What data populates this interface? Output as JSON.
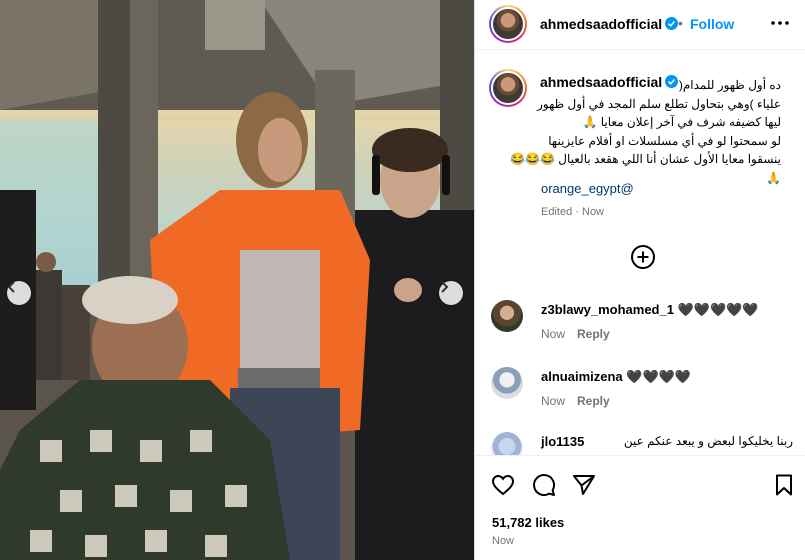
{
  "post": {
    "username": "ahmedsaadofficial",
    "follow_label": "Follow",
    "separator": "•",
    "caption_lines": [
      "ده أول ظهور للمدام( ",
      "علياء )وهي بتحاول تطلع سلم المجد في أول ظهور",
      "ليها كضيفه شرف في آخر إعلان معايا 🙏",
      "لو سمحتوا لو في أي مسلسلات او أفلام عايزينها",
      "ينسقوا معايا الأول عشان أنا اللي هقعد بالعيال 😂😂😂",
      "🙏"
    ],
    "mention": "orange_egypt@",
    "edited_label": "Edited",
    "edited_sep": "·",
    "edited_time": "Now",
    "likes": "51,782 likes",
    "post_time": "Now"
  },
  "comments": [
    {
      "username": "z3blawy_mohamed_1",
      "text": "🖤🖤🖤🖤🖤",
      "time": "Now",
      "reply": "Reply"
    },
    {
      "username": "alnuaimizena",
      "text": "🖤🖤🖤🖤",
      "time": "Now",
      "reply": "Reply"
    },
    {
      "username": "jlo1135",
      "text": "ربنا يخليكوا لبعض و يبعد عنكم عين",
      "time": "",
      "reply": ""
    }
  ],
  "icons": {
    "verified": "verified-badge-icon",
    "more": "more-options-icon",
    "add": "add-comment-circle-icon",
    "like": "heart-icon",
    "comment": "comment-icon",
    "share": "share-icon",
    "save": "bookmark-icon",
    "prev": "chevron-left-icon",
    "next": "chevron-right-icon"
  },
  "colors": {
    "follow": "#0095f6",
    "verified": "#0095f6",
    "mention": "#00376b",
    "muted": "#737373"
  }
}
